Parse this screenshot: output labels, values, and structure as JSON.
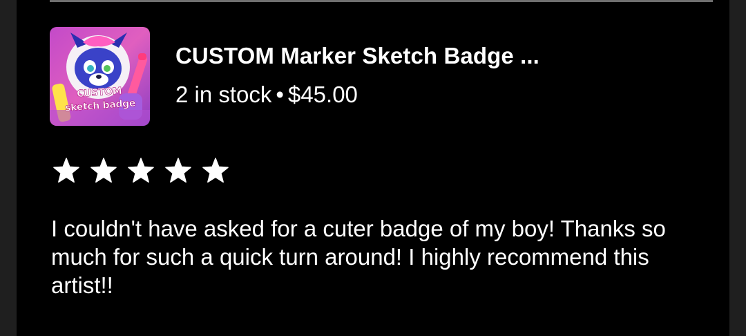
{
  "listing": {
    "title": "CUSTOM Marker Sketch Badge ...",
    "stock": "2 in stock",
    "separator": "•",
    "price": "$45.00",
    "thumbnail_caption_line1": "CUSTOM",
    "thumbnail_caption_line2": "sketch badge"
  },
  "rating": {
    "stars": 5,
    "max_stars": 5,
    "star_icon": "star-icon"
  },
  "review": {
    "text": "I couldn't have asked for a cuter badge of my boy! Thanks so much for such a quick turn around! I highly recommend this artist!!"
  },
  "colors": {
    "background": "#000000",
    "text": "#ffffff",
    "divider": "#6f6f6f"
  }
}
